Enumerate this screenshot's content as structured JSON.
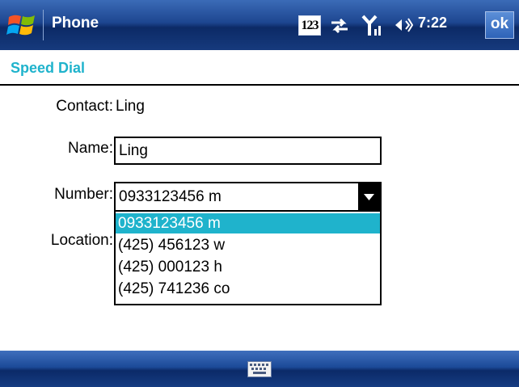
{
  "titlebar": {
    "app_title": "Phone",
    "input_indicator": "123",
    "clock": "7:22",
    "ok_label": "ok",
    "icons": [
      "windows-start-icon",
      "connectivity-icon",
      "signal-icon",
      "volume-icon"
    ]
  },
  "header": {
    "title": "Speed Dial"
  },
  "form": {
    "contact_label": "Contact:",
    "contact_value": "Ling",
    "name_label": "Name:",
    "name_value": "Ling",
    "number_label": "Number:",
    "number_value": "0933123456 m",
    "location_label": "Location:",
    "number_options": [
      {
        "label": "0933123456 m",
        "selected": true
      },
      {
        "label": "(425) 456123 w",
        "selected": false
      },
      {
        "label": "(425) 000123 h",
        "selected": false
      },
      {
        "label": "(425) 741236 co",
        "selected": false
      }
    ]
  },
  "bottombar": {
    "icons": [
      "keyboard-icon"
    ]
  },
  "colors": {
    "accent": "#1fb3cc",
    "titlebar": "#1d4690",
    "selection": "#1fb3cc"
  }
}
